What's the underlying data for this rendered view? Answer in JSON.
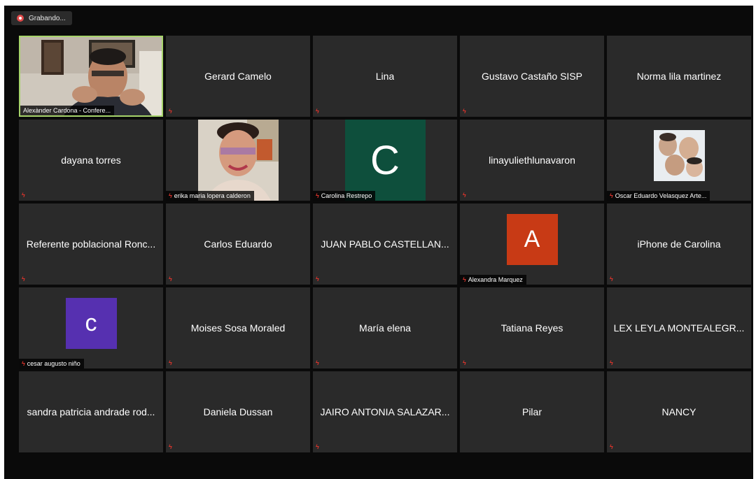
{
  "recording": {
    "label": "Grabando..."
  },
  "colors": {
    "active_border": "#a6d36a",
    "mute": "#e0342c",
    "tile_bg": "#2a2a2a",
    "background": "#0a0a0a"
  },
  "participants": [
    {
      "name": "Alexànder Cardona - Confere...",
      "type": "video",
      "active": true
    },
    {
      "name": "Gerard Camelo",
      "type": "name"
    },
    {
      "name": "Lina",
      "type": "name"
    },
    {
      "name": "Gustavo Castaño SISP",
      "type": "name"
    },
    {
      "name": "Norma lila martinez",
      "type": "name"
    },
    {
      "name": "dayana torres",
      "type": "name"
    },
    {
      "name": "erika maria lopera calderon",
      "type": "photo"
    },
    {
      "name": "Carolina Restrepo",
      "type": "avatar",
      "initial": "C",
      "color": "#0e4f3c"
    },
    {
      "name": "linayuliethlunavaron",
      "type": "name"
    },
    {
      "name": "Oscar Eduardo Velasquez Arte...",
      "type": "photo"
    },
    {
      "name": "Referente poblacional Ronc...",
      "type": "name"
    },
    {
      "name": "Carlos Eduardo",
      "type": "name"
    },
    {
      "name": "JUAN PABLO CASTELLAN...",
      "type": "name"
    },
    {
      "name": "Alexandra Marquez",
      "type": "avatar",
      "initial": "A",
      "color": "#c83a15"
    },
    {
      "name": "iPhone de Carolina",
      "type": "name"
    },
    {
      "name": "cesar augusto niño",
      "type": "avatar",
      "initial": "c",
      "color": "#5630b0"
    },
    {
      "name": "Moises Sosa Moraled",
      "type": "name"
    },
    {
      "name": "María elena",
      "type": "name"
    },
    {
      "name": "Tatiana Reyes",
      "type": "name"
    },
    {
      "name": "LEX LEYLA MONTEALEGR...",
      "type": "name"
    },
    {
      "name": "sandra patricia andrade rod...",
      "type": "name"
    },
    {
      "name": "Daniela Dussan",
      "type": "name"
    },
    {
      "name": "JAIRO ANTONIA SALAZAR...",
      "type": "name"
    },
    {
      "name": "Pilar",
      "type": "name"
    },
    {
      "name": "NANCY",
      "type": "name"
    }
  ]
}
